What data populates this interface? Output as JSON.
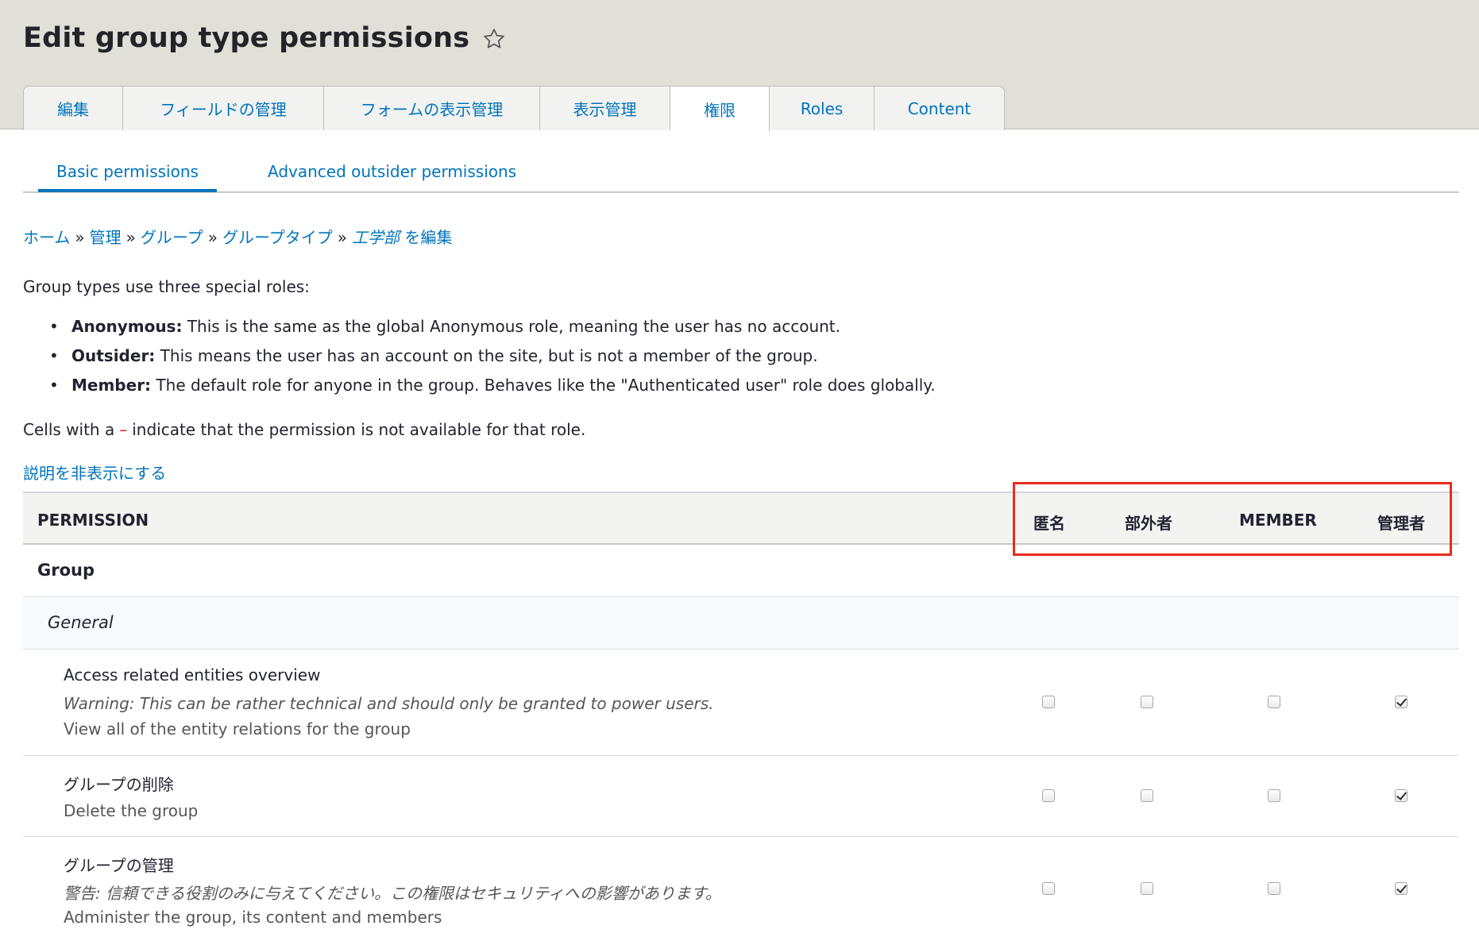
{
  "page": {
    "title": "Edit group type permissions",
    "star_icon": "star-outline-icon"
  },
  "primary_tabs": [
    {
      "label": "編集",
      "active": false
    },
    {
      "label": "フィールドの管理",
      "active": false
    },
    {
      "label": "フォームの表示管理",
      "active": false
    },
    {
      "label": "表示管理",
      "active": false
    },
    {
      "label": "権限",
      "active": true
    },
    {
      "label": "Roles",
      "active": false
    },
    {
      "label": "Content",
      "active": false
    }
  ],
  "secondary_tabs": [
    {
      "label": "Basic permissions",
      "active": true
    },
    {
      "label": "Advanced outsider permissions",
      "active": false
    }
  ],
  "breadcrumb": {
    "items": [
      "ホーム",
      "管理",
      "グループ",
      "グループタイプ"
    ],
    "separator": "»",
    "current_italic": "工学部",
    "current_suffix": " を編集"
  },
  "intro": {
    "text": "Group types use three special roles:",
    "roles": [
      {
        "name": "Anonymous:",
        "desc": " This is the same as the global Anonymous role, meaning the user has no account."
      },
      {
        "name": "Outsider:",
        "desc": " This means the user has an account on the site, but is not a member of the group."
      },
      {
        "name": "Member:",
        "desc": " The default role for anyone in the group. Behaves like the \"Authenticated user\" role does globally."
      }
    ],
    "cells_note_before": "Cells with a",
    "cells_note_dash": "–",
    "cells_note_after": "indicate that the permission is not available for that role.",
    "hide_descriptions_link": "説明を非表示にする"
  },
  "table": {
    "headers": {
      "permission": "PERMISSION",
      "roles": [
        "匿名",
        "部外者",
        "MEMBER",
        "管理者"
      ]
    },
    "group_label": "Group",
    "section_label": "General",
    "permissions": [
      {
        "title": "Access related entities overview",
        "warning": "Warning: This can be rather technical and should only be granted to power users.",
        "description": "View all of the entity relations for the group",
        "checked": [
          false,
          false,
          false,
          true
        ]
      },
      {
        "title": "グループの削除",
        "warning": "",
        "description": "Delete the group",
        "checked": [
          false,
          false,
          false,
          true
        ]
      },
      {
        "title": "グループの管理",
        "warning": "警告: 信頼できる役割のみに与えてください。この権限はセキュリティへの影響があります。",
        "description": "Administer the group, its content and members",
        "checked": [
          false,
          false,
          false,
          true
        ]
      }
    ]
  },
  "colors": {
    "link": "#0074bd",
    "highlight": "#e82b1e",
    "header_bg": "#e0e0d8",
    "section_bg": "#f6fafd"
  }
}
